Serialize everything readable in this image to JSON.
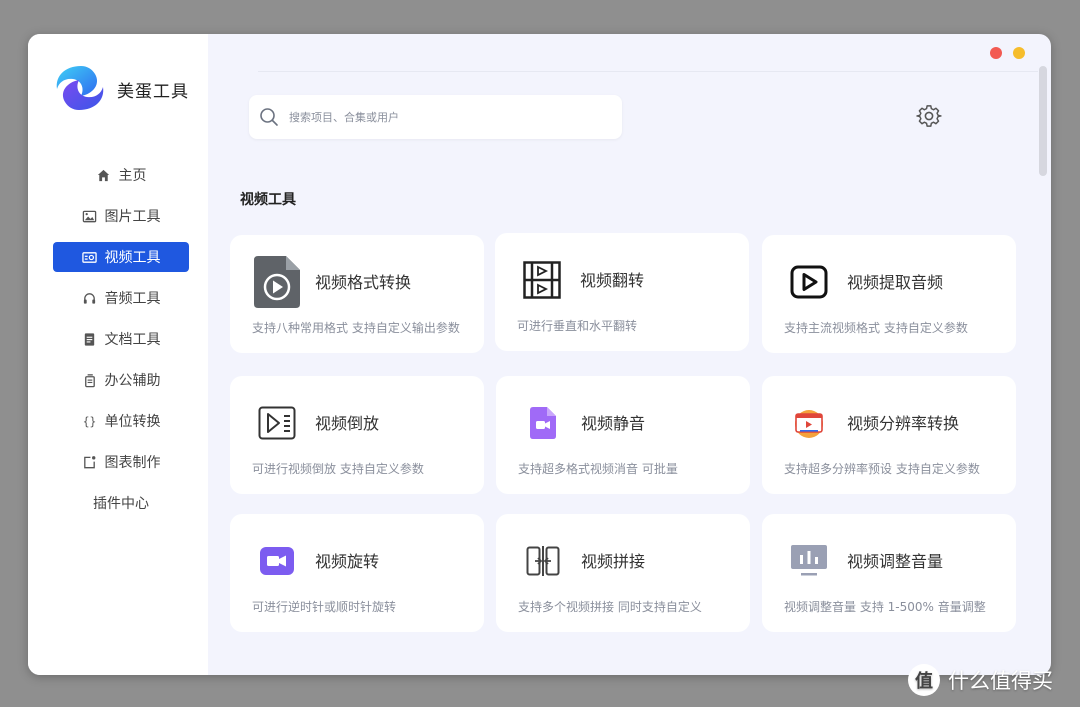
{
  "app": {
    "brand": "美蛋工具"
  },
  "sidebar": {
    "items": [
      {
        "label": "主页",
        "icon": "home-icon"
      },
      {
        "label": "图片工具",
        "icon": "image-icon"
      },
      {
        "label": "视频工具",
        "icon": "video-icon",
        "active": true
      },
      {
        "label": "音频工具",
        "icon": "headphones-icon"
      },
      {
        "label": "文档工具",
        "icon": "document-icon"
      },
      {
        "label": "办公辅助",
        "icon": "copy-icon"
      },
      {
        "label": "单位转换",
        "icon": "braces-icon"
      },
      {
        "label": "图表制作",
        "icon": "chart-icon"
      },
      {
        "label": "插件中心",
        "icon": ""
      }
    ]
  },
  "search": {
    "placeholder": "搜索项目、合集或用户",
    "value": ""
  },
  "section": {
    "title": "视频工具"
  },
  "cards": [
    {
      "title": "视频格式转换",
      "desc": "支持八种常用格式 支持自定义输出参数",
      "icon": "video-file-icon"
    },
    {
      "title": "视频翻转",
      "desc": "可进行垂直和水平翻转",
      "icon": "flip-icon"
    },
    {
      "title": "视频提取音频",
      "desc": "支持主流视频格式 支持自定义参数",
      "icon": "play-box-icon"
    },
    {
      "title": "视频倒放",
      "desc": "可进行视频倒放 支持自定义参数",
      "icon": "reverse-play-icon"
    },
    {
      "title": "视频静音",
      "desc": "支持超多格式视频消音 可批量",
      "icon": "mute-file-icon"
    },
    {
      "title": "视频分辨率转换",
      "desc": "支持超多分辨率预设 支持自定义参数",
      "icon": "resolution-icon"
    },
    {
      "title": "视频旋转",
      "desc": "可进行逆时针或顺时针旋转",
      "icon": "camera-icon"
    },
    {
      "title": "视频拼接",
      "desc": "支持多个视频拼接 同时支持自定义",
      "icon": "merge-icon"
    },
    {
      "title": "视频调整音量",
      "desc": "视频调整音量 支持 1-500% 音量调整",
      "icon": "volume-bars-icon"
    }
  ],
  "watermark": {
    "text": "什么值得买",
    "badge": "值"
  },
  "colors": {
    "accent": "#1f58e0",
    "background": "#f3f4fd",
    "purple": "#7c5cf0"
  }
}
